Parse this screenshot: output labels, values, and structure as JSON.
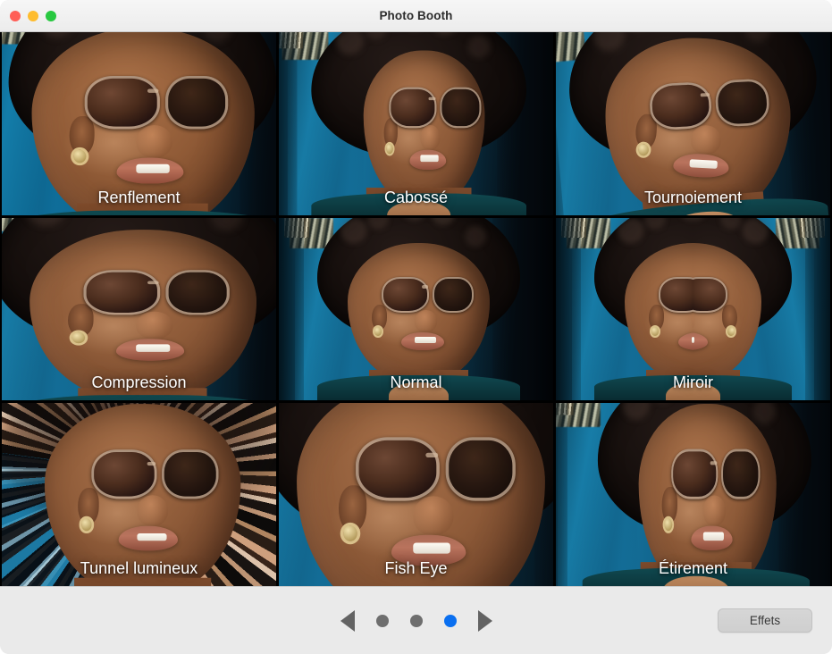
{
  "window": {
    "title": "Photo Booth",
    "traffic_lights": [
      {
        "name": "close",
        "color": "#ff5f57"
      },
      {
        "name": "minimize",
        "color": "#febc2e"
      },
      {
        "name": "zoom",
        "color": "#28c840"
      }
    ]
  },
  "effects_grid": {
    "rows": 3,
    "columns": 3,
    "cells": [
      {
        "label": "Renflement",
        "fx": "fx-bulge",
        "selected": false
      },
      {
        "label": "Cabossé",
        "fx": "fx-dent",
        "selected": false
      },
      {
        "label": "Tournoiement",
        "fx": "fx-twirl",
        "selected": false
      },
      {
        "label": "Compression",
        "fx": "fx-squeeze",
        "selected": false
      },
      {
        "label": "Normal",
        "fx": "fx-normal",
        "selected": false
      },
      {
        "label": "Miroir",
        "fx": "fx-mirror",
        "selected": false
      },
      {
        "label": "Tunnel lumineux",
        "fx": "fx-tunnel",
        "selected": false
      },
      {
        "label": "Fish Eye",
        "fx": "fx-fisheye",
        "selected": false
      },
      {
        "label": "Étirement",
        "fx": "fx-stretch",
        "selected": false
      }
    ]
  },
  "toolbar": {
    "previous_page_icon": "triangle-left-icon",
    "next_page_icon": "triangle-right-icon",
    "pages": [
      {
        "index": 1,
        "active": false
      },
      {
        "index": 2,
        "active": false
      },
      {
        "index": 3,
        "active": true
      }
    ],
    "active_page": 3,
    "total_pages": 3,
    "active_dot_color": "#0a6ff0",
    "inactive_dot_color": "#6e6e6e",
    "effects_button_label": "Effets"
  }
}
